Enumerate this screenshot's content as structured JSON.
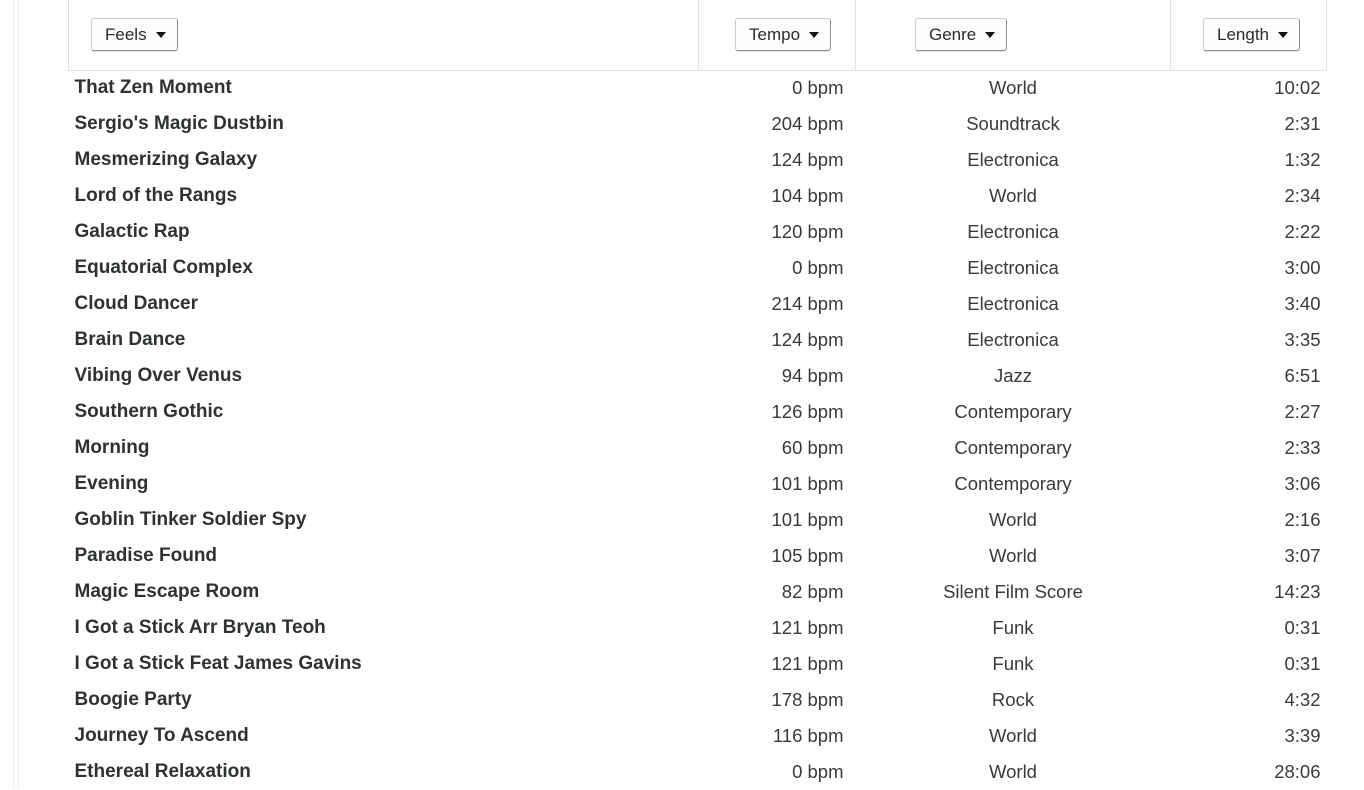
{
  "header": {
    "columns": [
      {
        "key": "title",
        "filter_label": "Feels",
        "icon": "chevron-down-icon"
      },
      {
        "key": "tempo",
        "filter_label": "Tempo",
        "icon": "chevron-down-icon"
      },
      {
        "key": "genre",
        "filter_label": "Genre",
        "icon": "chevron-down-icon"
      },
      {
        "key": "length",
        "filter_label": "Length",
        "icon": "chevron-down-icon"
      }
    ]
  },
  "tracks": [
    {
      "title": "That Zen Moment",
      "tempo": "0 bpm",
      "genre": "World",
      "length": "10:02"
    },
    {
      "title": "Sergio's Magic Dustbin",
      "tempo": "204 bpm",
      "genre": "Soundtrack",
      "length": "2:31"
    },
    {
      "title": "Mesmerizing Galaxy",
      "tempo": "124 bpm",
      "genre": "Electronica",
      "length": "1:32"
    },
    {
      "title": "Lord of the Rangs",
      "tempo": "104 bpm",
      "genre": "World",
      "length": "2:34"
    },
    {
      "title": "Galactic Rap",
      "tempo": "120 bpm",
      "genre": "Electronica",
      "length": "2:22"
    },
    {
      "title": "Equatorial Complex",
      "tempo": "0 bpm",
      "genre": "Electronica",
      "length": "3:00"
    },
    {
      "title": "Cloud Dancer",
      "tempo": "214 bpm",
      "genre": "Electronica",
      "length": "3:40"
    },
    {
      "title": "Brain Dance",
      "tempo": "124 bpm",
      "genre": "Electronica",
      "length": "3:35"
    },
    {
      "title": "Vibing Over Venus",
      "tempo": "94 bpm",
      "genre": "Jazz",
      "length": "6:51"
    },
    {
      "title": "Southern Gothic",
      "tempo": "126 bpm",
      "genre": "Contemporary",
      "length": "2:27"
    },
    {
      "title": "Morning",
      "tempo": "60 bpm",
      "genre": "Contemporary",
      "length": "2:33"
    },
    {
      "title": "Evening",
      "tempo": "101 bpm",
      "genre": "Contemporary",
      "length": "3:06"
    },
    {
      "title": "Goblin Tinker Soldier Spy",
      "tempo": "101 bpm",
      "genre": "World",
      "length": "2:16"
    },
    {
      "title": "Paradise Found",
      "tempo": "105 bpm",
      "genre": "World",
      "length": "3:07"
    },
    {
      "title": "Magic Escape Room",
      "tempo": "82 bpm",
      "genre": "Silent Film Score",
      "length": "14:23"
    },
    {
      "title": "I Got a Stick Arr Bryan Teoh",
      "tempo": "121 bpm",
      "genre": "Funk",
      "length": "0:31"
    },
    {
      "title": "I Got a Stick Feat James Gavins",
      "tempo": "121 bpm",
      "genre": "Funk",
      "length": "0:31"
    },
    {
      "title": "Boogie Party",
      "tempo": "178 bpm",
      "genre": "Rock",
      "length": "4:32"
    },
    {
      "title": "Journey To Ascend",
      "tempo": "116 bpm",
      "genre": "World",
      "length": "3:39"
    },
    {
      "title": "Ethereal Relaxation",
      "tempo": "0 bpm",
      "genre": "World",
      "length": "28:06"
    }
  ]
}
